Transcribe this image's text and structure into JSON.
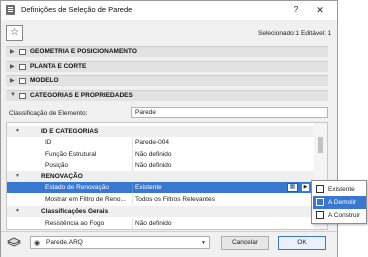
{
  "window": {
    "title": "Definições de Seleção de Parede",
    "help": "?",
    "close": "✕"
  },
  "toolbar": {
    "favorites_icon": "star-icon",
    "selection_info": "Selecionado:1 Editável: 1"
  },
  "sections": [
    {
      "label": "GEOMETRIA E POSICIONAMENTO",
      "icon": "geometry-icon",
      "expanded": false
    },
    {
      "label": "PLANTA E CORTE",
      "icon": "floorplan-icon",
      "expanded": false
    },
    {
      "label": "MODELO",
      "icon": "model-icon",
      "expanded": false
    },
    {
      "label": "CATEGORIAS E PROPRIEDADES",
      "icon": "properties-icon",
      "expanded": true
    }
  ],
  "classification": {
    "label": "Classificação de Elemento:",
    "value": "Parede"
  },
  "groups": {
    "id_cat": "ID E CATEGORIAS",
    "renov": "RENOVAÇÃO",
    "class_gerais": "Classificações Gerais"
  },
  "rows": {
    "id": {
      "name": "ID",
      "value": "Parede-004"
    },
    "funcao": {
      "name": "Função Estrutural",
      "value": "Não definido"
    },
    "posicao": {
      "name": "Posição",
      "value": "Não definido"
    },
    "estado": {
      "name": "Estado de Renovação",
      "value": "Existente"
    },
    "filtro": {
      "name": "Mostrar em Filtro de Reno...",
      "value": "Todos os Filtros Relevantes"
    },
    "resist": {
      "name": "Resistência ao Fogo",
      "value": "Não definido"
    }
  },
  "renovation_popup": {
    "items": [
      {
        "label": "Existente",
        "icon": "existing-icon",
        "active": false
      },
      {
        "label": "A Demolir",
        "icon": "demolish-icon",
        "active": true
      },
      {
        "label": "A Construir",
        "icon": "construct-icon",
        "active": false
      }
    ]
  },
  "footer": {
    "layer_icon": "layer-icon",
    "layer_value": "Parede.ARQ",
    "cancel_label": "Cancelar",
    "ok_label": "OK"
  },
  "colors": {
    "accent": "#3a78cf",
    "section_bg": "#e2e2e2"
  }
}
